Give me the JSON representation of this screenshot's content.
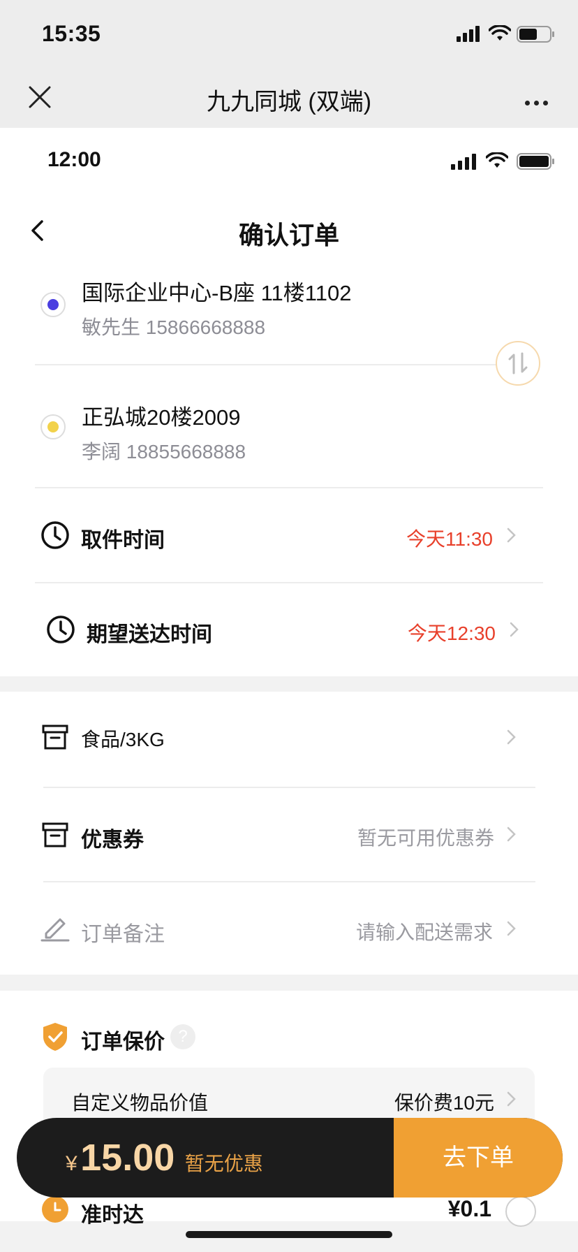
{
  "wechat_bar": {
    "time": "15:35",
    "title": "九九同城 (双端)"
  },
  "app_status": {
    "time": "12:00"
  },
  "header": {
    "title": "确认订单"
  },
  "pickup_address": {
    "line1": "国际企业中心-B座 11楼1102",
    "line2": "敏先生 15866668888",
    "dot_color": "#4a3ee0"
  },
  "delivery_address": {
    "line1": "正弘城20楼2009",
    "line2": "李阔 18855668888",
    "dot_color": "#f2d24b"
  },
  "pickup_time": {
    "label": "取件时间",
    "value": "今天11:30"
  },
  "expected_time": {
    "label": "期望送达时间",
    "value": "今天12:30"
  },
  "goods": {
    "label": "食品/3KG"
  },
  "coupon": {
    "label": "优惠券",
    "value": "暂无可用优惠券"
  },
  "remark": {
    "label": "订单备注",
    "placeholder": "请输入配送需求"
  },
  "insurance": {
    "title": "订单保价",
    "custom_label": "自定义物品价值",
    "custom_value": "保价费10元"
  },
  "on_time": {
    "label": "准时达",
    "price": "¥0.1"
  },
  "bottom_bar": {
    "currency": "¥",
    "price": "15.00",
    "promo": "暂无优惠",
    "submit": "去下单"
  },
  "colors": {
    "accent": "#f0a033",
    "price_red": "#e8402b"
  }
}
